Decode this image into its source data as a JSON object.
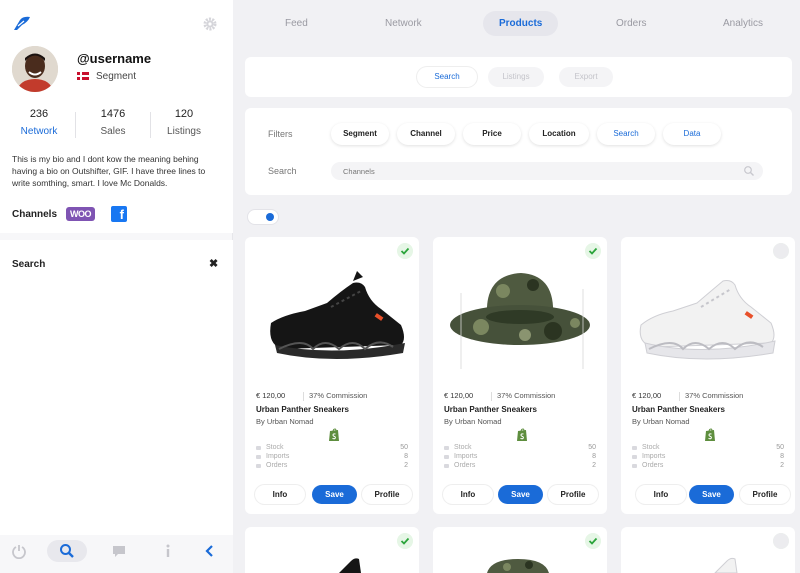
{
  "profile": {
    "username": "@username",
    "segment": "Segment",
    "stats": [
      {
        "value": "236",
        "label": "Network"
      },
      {
        "value": "1476",
        "label": "Sales"
      },
      {
        "value": "120",
        "label": "Listings"
      }
    ],
    "bio": "This is my bio and I dont kow the meaning behing having a bio on Outshifter, GIF. I have three lines to write somthing, smart. I love Mc Donalds.",
    "channels_label": "Channels",
    "woo_label": "WOO",
    "fb_label": "f"
  },
  "search_panel": {
    "title": "Search",
    "close": "✖"
  },
  "top_tabs": [
    "Feed",
    "Network",
    "Products",
    "Orders",
    "Analytics"
  ],
  "active_tab": "Products",
  "sub_tabs": [
    "Search",
    "Listings",
    "Export"
  ],
  "filters": {
    "label": "Filters",
    "chips": [
      "Segment",
      "Channel",
      "Price",
      "Location",
      "Search",
      "Data"
    ],
    "search_label": "Search",
    "channels_placeholder": "Channels"
  },
  "products": [
    {
      "price": "€ 120,00",
      "commission": "37% Commission",
      "title": "Urban Panther Sneakers",
      "vendor": "By Urban Nomad",
      "metrics": [
        {
          "label": "Stock",
          "value": "50"
        },
        {
          "label": "Imports",
          "value": "8"
        },
        {
          "label": "Orders",
          "value": "2"
        }
      ],
      "buttons": [
        "Info",
        "Save",
        "Profile"
      ],
      "checked": true
    },
    {
      "price": "€ 120,00",
      "commission": "37% Commission",
      "title": "Urban Panther Sneakers",
      "vendor": "By Urban Nomad",
      "metrics": [
        {
          "label": "Stock",
          "value": "50"
        },
        {
          "label": "Imports",
          "value": "8"
        },
        {
          "label": "Orders",
          "value": "2"
        }
      ],
      "buttons": [
        "Info",
        "Save",
        "Profile"
      ],
      "checked": true
    },
    {
      "price": "€ 120,00",
      "commission": "37% Commission",
      "title": "Urban Panther Sneakers",
      "vendor": "By Urban Nomad",
      "metrics": [
        {
          "label": "Stock",
          "value": "50"
        },
        {
          "label": "Imports",
          "value": "8"
        },
        {
          "label": "Orders",
          "value": "2"
        }
      ],
      "buttons": [
        "Info",
        "Save",
        "Profile"
      ],
      "checked": false
    }
  ],
  "colors": {
    "accent": "#1a6bd8",
    "check_green": "#2aa43a",
    "shopify_green": "#5e8e3e"
  },
  "icons": [
    "logo-icon",
    "gear-icon",
    "power-icon",
    "search-icon",
    "chat-icon",
    "info-icon",
    "collapse-arrow-icon",
    "check-icon",
    "shopify-icon"
  ]
}
